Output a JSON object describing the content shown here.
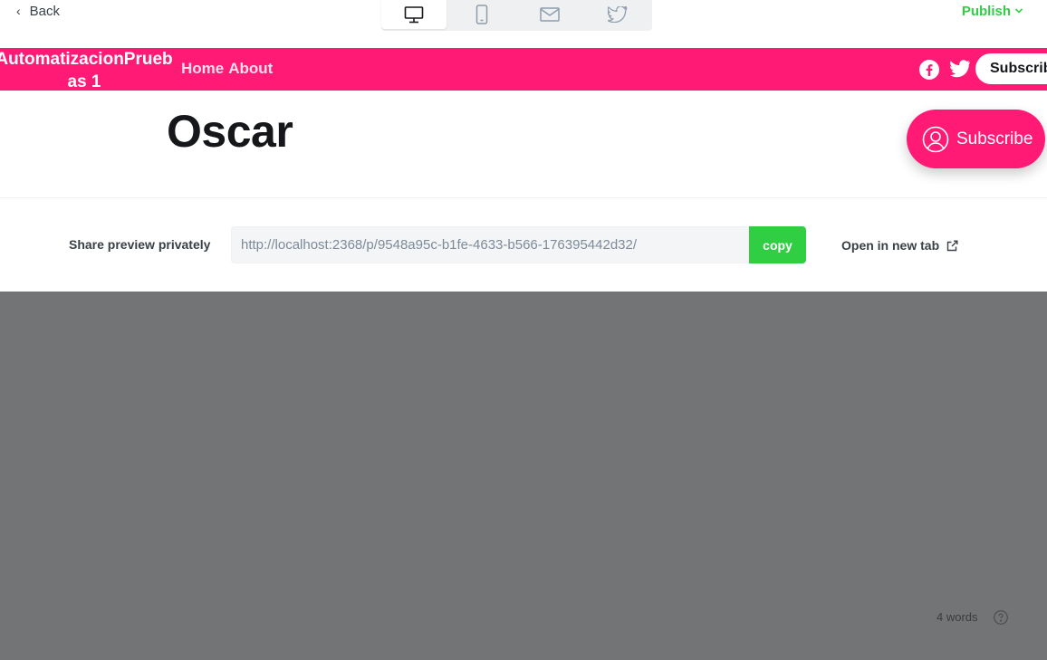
{
  "editor": {
    "back_label": "Back",
    "publish_label": "Publish",
    "device_modes": [
      "desktop",
      "mobile",
      "email",
      "twitter"
    ],
    "active_mode": "desktop"
  },
  "site": {
    "title": "AutomatizacionPrueb\nas 1",
    "nav": [
      "Home",
      "About"
    ],
    "subscribe_label": "Subscribe",
    "accent_color": "#ff1a75"
  },
  "post": {
    "title": "Oscar"
  },
  "portal": {
    "subscribe_label": "Subscribe"
  },
  "share": {
    "label": "Share preview privately",
    "url": "http://localhost:2368/p/9548a95c-b1fe-4633-b566-176395442d32/",
    "copy_label": "copy",
    "open_label": "Open in new tab"
  },
  "status": {
    "word_count": "4 words"
  },
  "colors": {
    "publish_green": "#30cf43",
    "overlay_gray": "#737476"
  }
}
